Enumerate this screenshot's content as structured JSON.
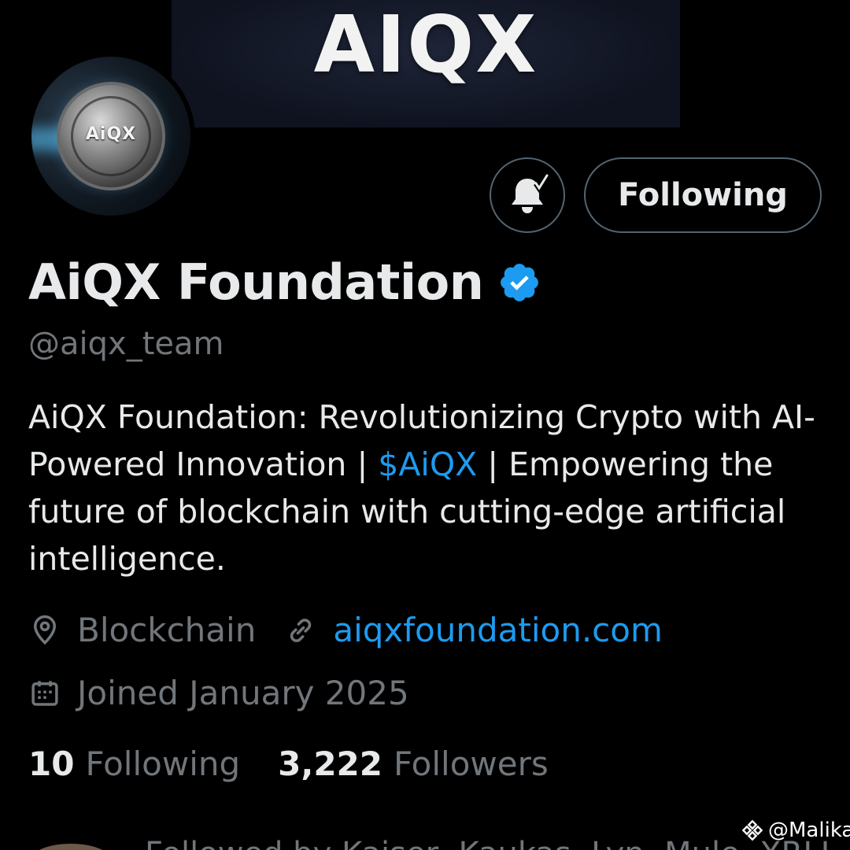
{
  "banner": {
    "logo_text": "AIQX"
  },
  "avatar": {
    "coin_text": "AiQX"
  },
  "actions": {
    "follow_label": "Following"
  },
  "profile": {
    "name": "AiQX Foundation",
    "handle": "@aiqx_team",
    "bio_part1": "AiQX Foundation: Revolutionizing Crypto with AI-Powered Innovation | ",
    "bio_cashtag": "$AiQX",
    "bio_part2": " | Empowering the future of blockchain with cutting-edge artificial intelligence.",
    "location": "Blockchain",
    "website": "aiqxfoundation.com",
    "joined": "Joined January 2025"
  },
  "stats": {
    "following_count": "10",
    "following_label": "Following",
    "followers_count": "3,222",
    "followers_label": "Followers"
  },
  "followed_by": "Followed by Kaiser, Kaukas, Lyn, Mule, XRLI... ",
  "watermark": "@Malika",
  "colors": {
    "accent": "#1d9bf0",
    "muted": "#71767b",
    "text": "#e7e9ea",
    "border": "#536471"
  },
  "icons": [
    "bell-notification-icon",
    "verified-badge-icon",
    "location-pin-icon",
    "link-icon",
    "calendar-icon"
  ]
}
